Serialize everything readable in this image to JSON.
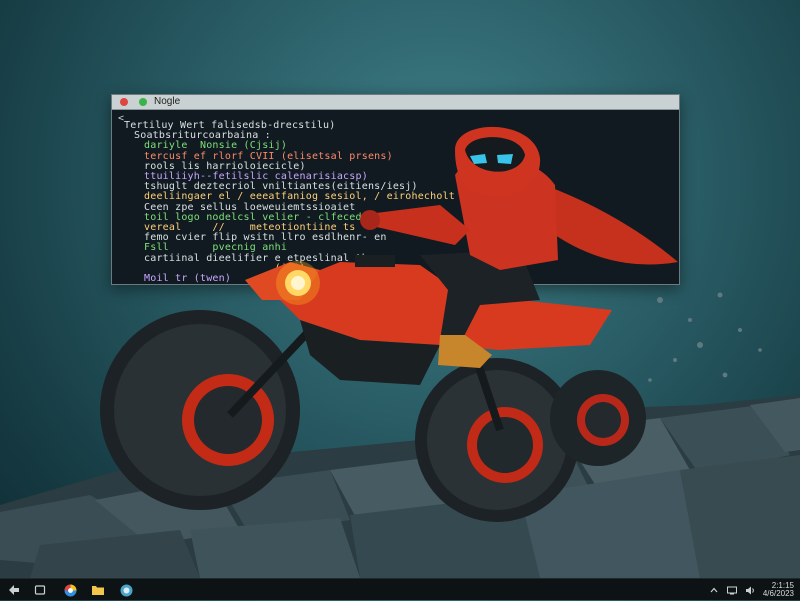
{
  "window": {
    "title": "Nogle",
    "prompt_glyph": "<",
    "lines": [
      {
        "text": "Tertiluy Wert falisedsb-drecstilu)",
        "color": "#d8e0e2",
        "indent": 12
      },
      {
        "text": "Soatbsriturcoarbaina :",
        "color": "#d8e0e2",
        "indent": 22
      },
      {
        "text": "dariyle  Nonsie (Cjsij)",
        "color": "#7fe07a",
        "indent": 32
      },
      {
        "text": "tercusf ef rlorf CVII (elisetsal prsens)",
        "color": "#ff8a6a",
        "indent": 32
      },
      {
        "text": "rools lis harrioloiecicle)",
        "color": "#d8e0e2",
        "indent": 32
      },
      {
        "text": "ttuiliiyh--fetilslic calenarisiacsp)",
        "color": "#c9a7ff",
        "indent": 32
      },
      {
        "text": "tshuglt deztecriol vniltiantes(eitiens/iesj)",
        "color": "#d8e0e2",
        "indent": 32
      },
      {
        "text": "deeliingaer el / eeeatfaniog sesiol, / eirohecholt",
        "color": "#ffd07a",
        "indent": 32
      },
      {
        "text": "Ceen zpe sellus loeweuiemtssioaiet",
        "color": "#d8e0e2",
        "indent": 32
      },
      {
        "text": "toil logo nodelcsl velier - clfecedirs-",
        "color": "#7fe07a",
        "indent": 32
      },
      {
        "text": "vereal     //    meteotiontiine ts",
        "color": "#ffd07a",
        "indent": 32
      },
      {
        "text": "femo cvier flip wsitn llro esdlhenr- en",
        "color": "#d8e0e2",
        "indent": 32
      },
      {
        "text": "Fsll       pvecnig anhi",
        "color": "#7fe07a",
        "indent": 32
      },
      {
        "text": "cartiinal dieelifier e etpeslinal ths",
        "color": "#d8e0e2",
        "indent": 32
      },
      {
        "text": "                     (ili)",
        "color": "#ffd07a",
        "indent": 32
      },
      {
        "text": "Moil tr (twen)",
        "color": "#c9a7ff",
        "indent": 32
      }
    ]
  },
  "taskbar": {
    "clock_time": "2:1:15",
    "clock_date": "4/6/2023",
    "icons": [
      "start-icon",
      "task-view-icon",
      "browser-icon",
      "file-explorer-icon",
      "app-icon"
    ],
    "tray_icons": [
      "chevron-up-icon",
      "network-icon",
      "volume-icon"
    ]
  },
  "colors": {
    "accent_red": "#d83a1f",
    "headlight": "#ffb020",
    "terminal_bg": "#101a20"
  }
}
